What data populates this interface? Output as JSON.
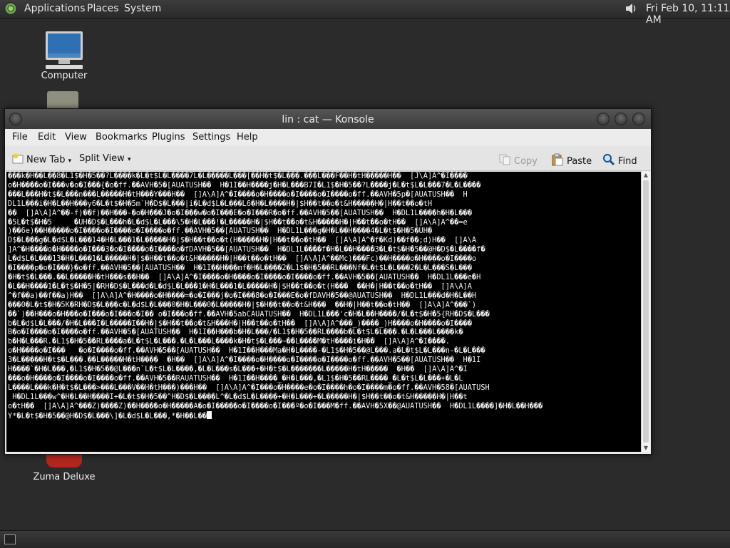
{
  "top_panel": {
    "menus": [
      "Applications",
      "Places",
      "System"
    ],
    "clock": "Fri Feb 10, 11:11 AM"
  },
  "desktop": {
    "icons": {
      "computer": "Computer",
      "zuma": "Zuma Deluxe"
    }
  },
  "window": {
    "title": "lin : cat — Konsole",
    "menu": [
      "File",
      "Edit",
      "View",
      "Bookmarks",
      "Plugins",
      "Settings",
      "Help"
    ],
    "toolbar": {
      "new_tab": "New Tab",
      "split_view": "Split View",
      "copy": "Copy",
      "paste": "Paste",
      "find": "Find"
    },
    "terminal_lines": [
      "���k�H��L��8�L1$�H�5��?L����k�L�t$L�L����7L�L�����L���[��H�t$�L���.���L���F��H�tH�����H��  [J\\A]A^�I����",
      "o�H����o�I���v�o�I���{�o�ff.��AVH�5�[AUATUSH��  H�1I��H����j�H�L���B7I�L1$�H�5��?L����j�L�t$L�L���7�L�L����",
      "���L���H�t$�L���n���L�����H�tH���Y���H��  []A\\A]A^�I����o�H����o�I����o�I����o�ff.��AVH�5p�[AUATUSH��  H",
      "DL1L���i�H�L��H���y6�L�t$�H�5m`H�D$�L���|i�L�d$L�L���L6�H�L����H�|$H��t��o�t&H�����H�|H��t��o�tH",
      "��  []A\\A]A^��-f)��f)��H���-�o�H���J�o�I���w�o�I���E�o�I���R�o�ff.��AVH�5��[AUATUSH��  H�DL1L����h�H�L���",
      "�5L�t$�H�5     �UH�D$�L���h�L�d$L�L���\\5�H�L���!�L�����H�|$H��t��o�t&H�����H�|H��t��o�tH��  []A\\A]A^��=e",
      ")��6e)��H�����o�I����o�I����o�I����o�ff.��AVH�5��[AUATUSH��  H�DL1L���g�H�L��H����4�L�t$�H�5�UH�",
      "D$�L���g�L�d$L�L���14�H�L���1�L�����H�|$�H��t��o�t(H�����H�|H��t��o�tH��  []A\\A]A^�f�Kd)��f��;d)H��  []A\\A",
      "]A^�H����o�H����o�I���3�o�I����o�I����o�fDAVH�5��[AUATUSH��  H�DL1L����f�H�L��H����3�L�t$�H�5��@H�D$�L����f�",
      "L�d$L�L���13�H�L���1�L�����H�|$�H��t��o�t&H�����H�|H��t��o�tH��  []A\\A]A^��Mc)���Fc)��H����o�H����o�I����o",
      "�I����p�o�I���}�o�ff.��AVH�5��[AUATUSH��  H�1I��H���mf�H�L����2�L1$�H�5��RL���Nf�L�t$L�L���2�L�L���S�L���",
      "",
      "�H�t$�L���.��L�����H�tH���s��H��  []A\\A]A^�I����o�H����o�I����o�I����o�ff.��AVH�5��[AUATUSH��  H�DL1L���e�H",
      "�L��H����1�L�t$�H�5|�RH�D$�L���d�L�d$L�L���1�H�L���1�L�����H�|$H��t��o�t(H���  ��H�|H��t��o�tH��  []A\\A]A",
      "^�f��a)��f��a)H��  []A\\A]A^�H����o�H����=�o�I���j�o�I���8�o�I���E�o�fDAVH�5��@AUATUSH��  H�DL1L���d�H�L��H",
      "���0�L�t$�H�5K�RH�D$�L���c�L�d$L�L���0�H�L���0�L�����H�|$�H��t��o�t&H���  ��H�|H��t��o�tH��  []A\\A]A^���`)",
      "��`)��H���o�H���o�I���o�I���o�I�� o�I���o�ff.��AVH�5abCAUATUSH��  H�DL1L���'c�H�L��H����/�L�t$�H�5{RH�D$�L���",
      "b�L�d$L�L���/�H�L���I�L�����I��H�|$�H��t��o�t&H���H�|H��t��o�tH��  []A\\A]A^���_)����_)H����o�H����o�I����",
      "B�o�I����o�I����o�ff.��AVH�5�[AUATUSH��  H�1I��H���b�H�L���/�L1$�H�5��RL����b�L�t$L�L���.�L�L���L����k�",
      "b�H�L���R.�L1$�H�5��RL����a�L�t$L�L���.�L�L���L����k�H�t$�L���~��L����M�tH����i�H��  []A\\A]A^�I����.",
      "o�H����o�I���   �o�I����o�ff.��AVH�5��[AUATUSH��  H�1I��H���Ma�H�L����-�L1$�H�5��@L���.a�L�t$L�L���n-�L�L���",
      "3�L�����H�t$�L���.��L�����H�tH����  �H��  []A\\A]A^�I����o�H����o�I����o�I����o�ff.��AVH�5��[AUATUSH��  H�1I",
      "H����`�H�L���,�L1$�H�5��@L���n`L�t$L�L����,�L�L���s�L���+�H�t$�L�������L�����H�tH�����  �H��  []A\\A]A^�I",
      "���o�H����o�I����o�I����o�ff.��AVH�5��RAUATUSH��  H�1I��H����_�H�L���,�L1$�H�5��RL����_�L�t$L�L���+�L�L",
      "L����L���k�H�t$�L���>���L���V��H�tH���)���H��  []A\\A]A^�I���o�H����e�o�I����h�o�I����m�o�ff.��AVH�58�[AUATUSH",
      " H�DL1L���w^�H�L��H����I+�L�t$�H�5��^H�D$�L����L^�L�d$L�L����+�H�L���+�L�����H�|$H��t��o�t&H�����H�|H��t",
      "o�tH��  []A\\A]A^���Z)����Z)��H����o�H�����A�o�I�����o�I����o�I���º�o�I���M�ff.��AVH�5X��@AUATUSH��  H�DL1L����]�H�L��H���",
      "Y*�L�t$�H�5��@H�D$�L���\\]�L�d$L�L���,*�H��L��"
    ]
  }
}
